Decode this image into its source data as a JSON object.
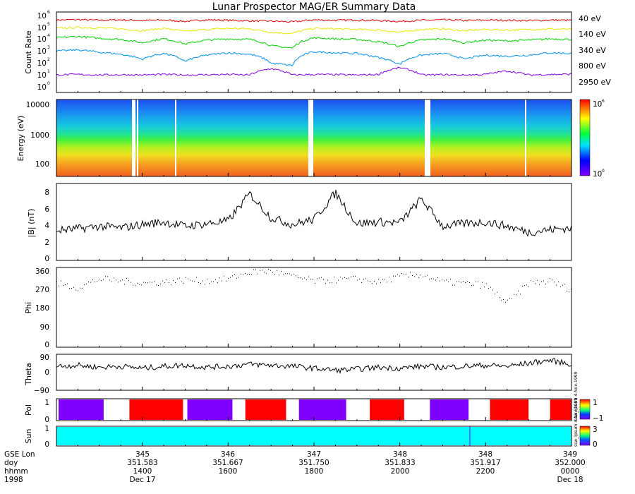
{
  "title": "Lunar Prospector MAG/ER Summary Data",
  "colors": {
    "e40": "#e00000",
    "e140": "#e8e800",
    "e340": "#00d000",
    "e800": "#0090e8",
    "e2950": "#8000e0",
    "polPos": "#ff0000",
    "polNeg": "#8000ff",
    "sun": "#00ffff"
  },
  "panels": {
    "count": {
      "ylabel": "Count Rate",
      "ticks": [
        "10",
        "10",
        "10",
        "10",
        "10",
        "10",
        "10"
      ],
      "exps": [
        "0",
        "1",
        "2",
        "3",
        "4",
        "5",
        "6"
      ],
      "legend": [
        "40 eV",
        "140 eV",
        "340 eV",
        "800 eV",
        "2950 eV"
      ]
    },
    "energy": {
      "ylabel": "Energy (eV)",
      "ticks": [
        "100",
        "1000",
        "10000"
      ],
      "cbar": {
        "min_base": "10",
        "min_exp": "0",
        "max_base": "10",
        "max_exp": "6"
      }
    },
    "bmag": {
      "ylabel": "|B| (nT)",
      "ticks": [
        "0",
        "2",
        "4",
        "6",
        "8"
      ]
    },
    "phi": {
      "ylabel": "Phi",
      "ticks": [
        "0",
        "90",
        "180",
        "270",
        "360"
      ]
    },
    "theta": {
      "ylabel": "Theta",
      "ticks": [
        "−90",
        "0",
        "90"
      ]
    },
    "pol": {
      "ylabel": "Pol",
      "ticks": [
        "0",
        "1"
      ],
      "cbar": {
        "max": "1",
        "min": "−1"
      },
      "side_text": "ssw_lpsum 4-Nov-1999"
    },
    "sun": {
      "ylabel": "Sun",
      "ticks": [
        "0",
        "1"
      ],
      "cbar": {
        "max": "3",
        "min": "0"
      },
      "side_text": "ssw_lpsum 4-Nov-1999"
    }
  },
  "xaxis": {
    "row_labels": [
      "GSE Lon",
      "doy",
      "hhmm",
      "1998"
    ],
    "ticks": [
      {
        "lon": "345",
        "doy": "351.583",
        "hhmm": "1400",
        "date": "Dec 17"
      },
      {
        "lon": "346",
        "doy": "351.667",
        "hhmm": "1600",
        "date": ""
      },
      {
        "lon": "347",
        "doy": "351.750",
        "hhmm": "1800",
        "date": ""
      },
      {
        "lon": "348",
        "doy": "351.833",
        "hhmm": "2000",
        "date": ""
      },
      {
        "lon": "348",
        "doy": "351.917",
        "hhmm": "2200",
        "date": ""
      },
      {
        "lon": "349",
        "doy": "352.000",
        "hhmm": "0000",
        "date": "Dec 18"
      }
    ]
  },
  "chart_data": [
    {
      "type": "line",
      "title": "Lunar Prospector MAG/ER Summary Data",
      "ylabel": "Count Rate",
      "yscale": "log",
      "ylim": [
        1,
        1000000
      ],
      "xlim": [
        12.0,
        24.0
      ],
      "x": [
        12.0,
        12.5,
        13.0,
        13.5,
        14.0,
        14.5,
        15.0,
        15.5,
        16.0,
        16.5,
        17.0,
        17.5,
        18.0,
        18.5,
        19.0,
        19.5,
        20.0,
        20.5,
        21.0,
        21.5,
        22.0,
        22.5,
        23.0,
        23.5,
        24.0
      ],
      "series": [
        {
          "name": "40 eV",
          "values": [
            250000,
            270000,
            240000,
            260000,
            230000,
            250000,
            200000,
            260000,
            240000,
            220000,
            210000,
            180000,
            260000,
            240000,
            250000,
            230000,
            200000,
            240000,
            260000,
            230000,
            250000,
            240000,
            230000,
            250000,
            240000
          ]
        },
        {
          "name": "140 eV",
          "values": [
            60000,
            70000,
            65000,
            55000,
            40000,
            60000,
            35000,
            50000,
            60000,
            55000,
            30000,
            25000,
            60000,
            55000,
            50000,
            45000,
            30000,
            50000,
            55000,
            40000,
            50000,
            45000,
            50000,
            55000,
            50000
          ]
        },
        {
          "name": "340 eV",
          "values": [
            12000,
            15000,
            11000,
            9000,
            5000,
            10000,
            4000,
            8000,
            10000,
            9000,
            3000,
            2000,
            12000,
            10000,
            9000,
            6000,
            2500,
            8000,
            10000,
            5000,
            8000,
            7000,
            8000,
            10000,
            9000
          ]
        },
        {
          "name": "800 eV",
          "values": [
            1200,
            1500,
            1000,
            700,
            300,
            800,
            200,
            600,
            900,
            700,
            150,
            100,
            1100,
            900,
            800,
            400,
            120,
            600,
            800,
            300,
            600,
            500,
            600,
            900,
            800
          ]
        },
        {
          "name": "2950 eV",
          "values": [
            20,
            22,
            20,
            21,
            20,
            22,
            20,
            21,
            22,
            20,
            60,
            20,
            22,
            21,
            20,
            22,
            70,
            20,
            21,
            20,
            22,
            40,
            20,
            22,
            23
          ]
        }
      ]
    },
    {
      "type": "heatmap",
      "ylabel": "Energy (eV)",
      "yscale": "log",
      "ylim": [
        40,
        15000
      ],
      "color_range": [
        1,
        1000000
      ]
    },
    {
      "type": "line",
      "ylabel": "|B| (nT)",
      "ylim": [
        0,
        9
      ],
      "x": [
        12.0,
        12.5,
        13.0,
        13.5,
        14.0,
        14.5,
        15.0,
        15.5,
        16.0,
        16.5,
        17.0,
        17.5,
        18.0,
        18.5,
        19.0,
        19.5,
        20.0,
        20.5,
        21.0,
        21.5,
        22.0,
        22.5,
        23.0,
        23.5,
        24.0
      ],
      "values": [
        3.5,
        3.7,
        4.0,
        3.8,
        4.2,
        4.5,
        4.0,
        4.3,
        4.6,
        7.8,
        5.0,
        4.2,
        4.8,
        7.9,
        4.3,
        4.5,
        4.4,
        7.2,
        4.0,
        4.3,
        4.5,
        4.0,
        3.3,
        3.6,
        3.8
      ]
    },
    {
      "type": "scatter",
      "ylabel": "Phi",
      "ylim": [
        0,
        360
      ],
      "x": [
        12.0,
        12.5,
        13.0,
        13.5,
        14.0,
        14.5,
        15.0,
        15.5,
        16.0,
        16.5,
        17.0,
        17.5,
        18.0,
        18.5,
        19.0,
        19.5,
        20.0,
        20.5,
        21.0,
        21.5,
        22.0,
        22.5,
        23.0,
        23.5,
        24.0
      ],
      "values": [
        290,
        270,
        310,
        300,
        290,
        295,
        305,
        300,
        310,
        340,
        345,
        320,
        300,
        305,
        310,
        295,
        320,
        330,
        295,
        290,
        280,
        200,
        290,
        300,
        260
      ]
    },
    {
      "type": "line",
      "ylabel": "Theta",
      "ylim": [
        -90,
        90
      ],
      "x": [
        12.0,
        12.5,
        13.0,
        13.5,
        14.0,
        14.5,
        15.0,
        15.5,
        16.0,
        16.5,
        17.0,
        17.5,
        18.0,
        18.5,
        19.0,
        19.5,
        20.0,
        20.5,
        21.0,
        21.5,
        22.0,
        22.5,
        23.0,
        23.5,
        24.0
      ],
      "values": [
        30,
        35,
        25,
        30,
        20,
        30,
        35,
        25,
        30,
        40,
        35,
        30,
        20,
        10,
        15,
        25,
        20,
        30,
        25,
        30,
        35,
        30,
        45,
        60,
        40
      ]
    },
    {
      "type": "bar",
      "ylabel": "Pol",
      "ylim": [
        0,
        1
      ],
      "segments": [
        {
          "start": 12.05,
          "end": 13.1,
          "value": -1
        },
        {
          "start": 13.7,
          "end": 14.95,
          "value": 1
        },
        {
          "start": 15.05,
          "end": 16.1,
          "value": -1
        },
        {
          "start": 16.4,
          "end": 17.35,
          "value": 1
        },
        {
          "start": 17.65,
          "end": 18.75,
          "value": -1
        },
        {
          "start": 19.3,
          "end": 20.1,
          "value": 1
        },
        {
          "start": 20.7,
          "end": 21.6,
          "value": -1
        },
        {
          "start": 22.1,
          "end": 23.0,
          "value": 1
        },
        {
          "start": 23.5,
          "end": 24.0,
          "value": 1
        }
      ]
    },
    {
      "type": "bar",
      "ylabel": "Sun",
      "ylim": [
        0,
        1
      ],
      "segments": [
        {
          "start": 12.0,
          "end": 24.0,
          "value": 1
        }
      ]
    }
  ]
}
